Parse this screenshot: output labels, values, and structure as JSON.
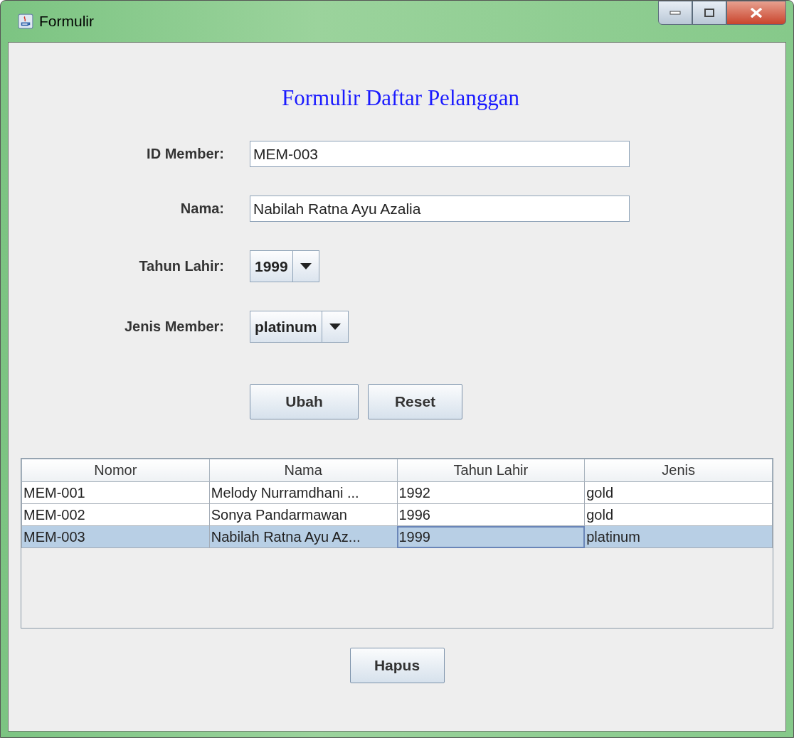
{
  "window": {
    "title": "Formulir"
  },
  "heading": "Formulir Daftar Pelanggan",
  "fields": [
    {
      "kind": "text",
      "label": "ID Member:",
      "value": "MEM-003"
    },
    {
      "kind": "text",
      "label": "Nama:",
      "value": "Nabilah Ratna Ayu Azalia"
    },
    {
      "kind": "combo",
      "label": "Tahun Lahir:",
      "value": "1999"
    },
    {
      "kind": "combo",
      "label": "Jenis Member:",
      "value": "platinum"
    }
  ],
  "buttons": [
    "Ubah",
    "Reset"
  ],
  "table": {
    "columns": [
      "Nomor",
      "Nama",
      "Tahun Lahir",
      "Jenis"
    ],
    "rows": [
      {
        "cells": [
          "MEM-001",
          "Melody Nurramdhani ...",
          "1992",
          "gold"
        ],
        "selected": false
      },
      {
        "cells": [
          "MEM-002",
          "Sonya Pandarmawan",
          "1996",
          "gold"
        ],
        "selected": false
      },
      {
        "cells": [
          "MEM-003",
          "Nabilah Ratna Ayu Az...",
          "1999",
          "platinum"
        ],
        "selected": true
      }
    ]
  },
  "bottom_button": "Hapus"
}
